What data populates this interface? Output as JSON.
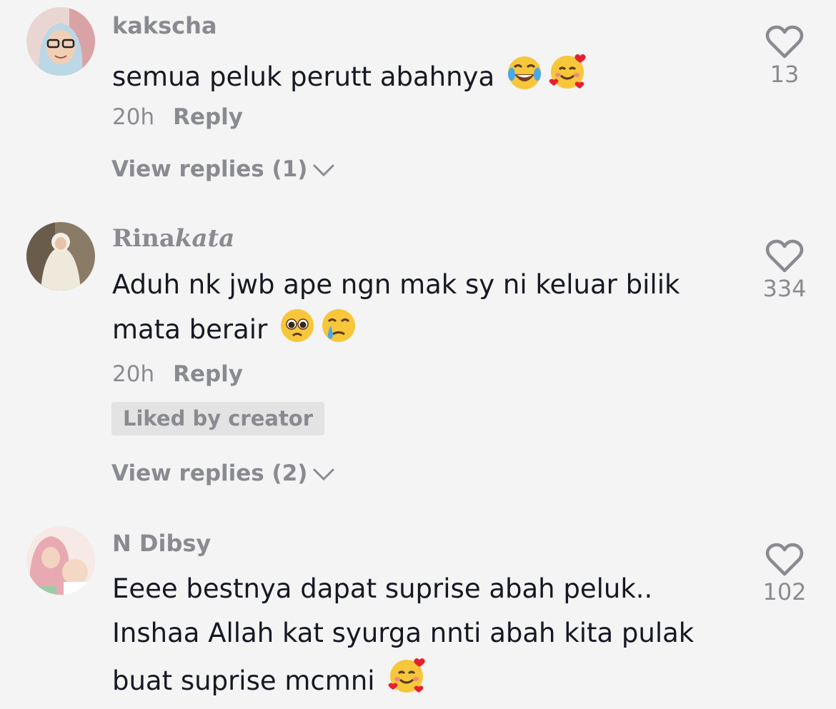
{
  "comments": [
    {
      "username": "kakscha",
      "lines": [
        "semua peluk perutt abahnya"
      ],
      "emoji_icons": [
        "face-with-tears-of-joy-icon",
        "smiling-face-with-hearts-icon"
      ],
      "time": "20h",
      "reply_label": "Reply",
      "view_replies": "View replies (1)",
      "likes": "13"
    },
    {
      "username_part1": "Rina",
      "username_part2": "kata",
      "lines": [
        "Aduh nk jwb ape ngn mak sy ni keluar bilik",
        "mata berair"
      ],
      "emoji_icons": [
        "pleading-face-icon",
        "face-holding-back-tears-icon"
      ],
      "time": "20h",
      "reply_label": "Reply",
      "badge": "Liked by creator",
      "view_replies": "View replies (2)",
      "likes": "334"
    },
    {
      "username": "N Dibsy",
      "lines": [
        "Eeee bestnya dapat suprise abah peluk..",
        "Inshaa Allah kat syurga nnti abah kita pulak",
        "buat suprise mcmni"
      ],
      "emoji_icons": [
        "smiling-face-with-hearts-icon"
      ],
      "likes": "102"
    }
  ],
  "colors": {
    "background": "#f4f4f4",
    "text": "#161823",
    "muted": "#8a8b91",
    "badge_bg": "#e3e3e4"
  }
}
